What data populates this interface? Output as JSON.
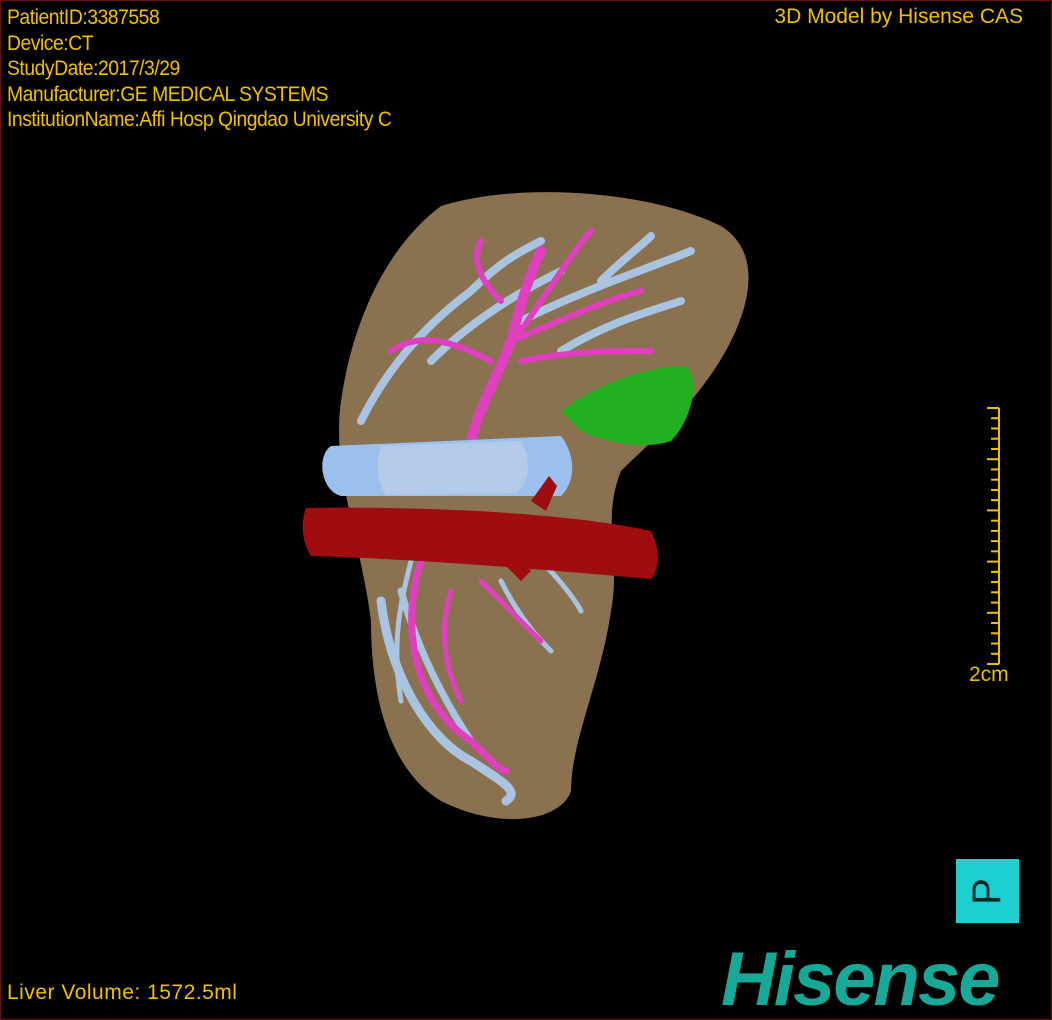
{
  "overlay": {
    "patient_id": "PatientID:3387558",
    "device": "Device:CT",
    "study_date": "StudyDate:2017/3/29",
    "manufacturer": "Manufacturer:GE MEDICAL SYSTEMS",
    "institution": "InstitutionName:Affi Hosp Qingdao University C",
    "credit": "3D Model by Hisense CAS",
    "liver_volume": "Liver Volume: 1572.5ml"
  },
  "scale_bar": {
    "label": "2cm",
    "color": "#f0c000"
  },
  "orientation_marker": {
    "label": "P",
    "color": "#1ecfcf"
  },
  "brand": {
    "logo": "Hisense",
    "color": "#17a898"
  },
  "model_colors": {
    "liver": "#8a7150",
    "portal_vein": "#a9c4e0",
    "hepatic_artery": "#e040c0",
    "ivc": "#9cc0ee",
    "aorta": "#a00d10",
    "gallbladder": "#22b020"
  }
}
